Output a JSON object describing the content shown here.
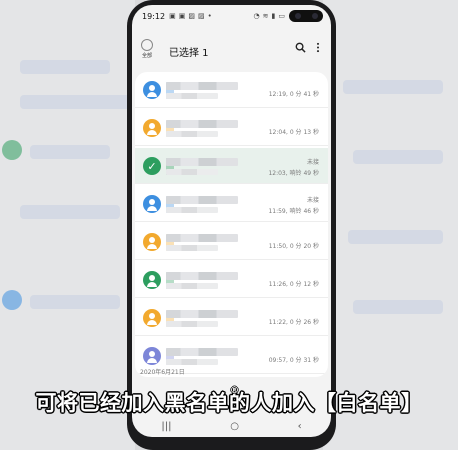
{
  "status_bar": {
    "time": "19:12",
    "left_icons": [
      "message-icon",
      "message-icon",
      "image-icon",
      "image-icon",
      "dot"
    ],
    "right_icons": [
      "alarm-icon",
      "wifi-icon",
      "signal-icon",
      "battery-icon"
    ]
  },
  "header": {
    "select_all_label": "全部",
    "title": "已选择 1",
    "search_icon": "search-icon",
    "more_icon": "more-vertical-icon"
  },
  "call_log": [
    {
      "avatar_color": "#3d8fe0",
      "selected": false,
      "tag": "",
      "meta": "12:19, 0 分 41 秒"
    },
    {
      "avatar_color": "#f2a92e",
      "selected": false,
      "tag": "",
      "meta": "12:04, 0 分 13 秒"
    },
    {
      "avatar_color": "#2d9e5f",
      "selected": true,
      "tag": "未接",
      "meta": "12:03, 响铃 49 秒"
    },
    {
      "avatar_color": "#3d8fe0",
      "selected": false,
      "tag": "未接",
      "meta": "11:59, 响铃 46 秒"
    },
    {
      "avatar_color": "#f2a92e",
      "selected": false,
      "tag": "",
      "meta": "11:50, 0 分 20 秒"
    },
    {
      "avatar_color": "#2d9e5f",
      "selected": false,
      "tag": "",
      "meta": "11:26, 0 分 12 秒"
    },
    {
      "avatar_color": "#f2a92e",
      "selected": false,
      "tag": "",
      "meta": "11:22, 0 分 26 秒"
    },
    {
      "avatar_color": "#7d86d8",
      "selected": false,
      "tag": "",
      "meta": "09:57, 0 分 31 秒"
    }
  ],
  "date_separator": "2020年6月21日",
  "nav_bar": {
    "recents": "|||",
    "home": "○",
    "back": "‹"
  },
  "caption": "可将已经加入黑名单的人加入【白名单】",
  "caption_mark": "®"
}
